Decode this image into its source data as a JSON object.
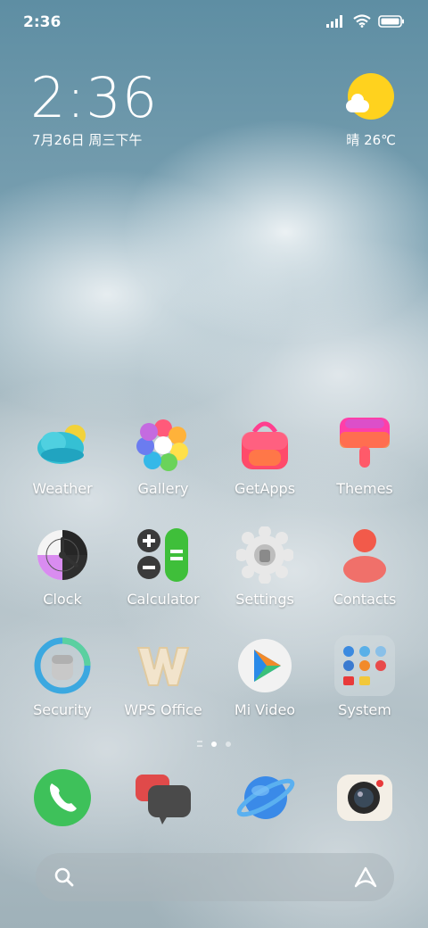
{
  "status": {
    "time": "2:36"
  },
  "clock_widget": {
    "time": "2:36",
    "date": "7月26日 周三下午"
  },
  "weather_widget": {
    "text": "晴 26℃"
  },
  "apps": [
    {
      "label": "Weather",
      "icon": "weather-icon"
    },
    {
      "label": "Gallery",
      "icon": "gallery-icon"
    },
    {
      "label": "GetApps",
      "icon": "getapps-icon"
    },
    {
      "label": "Themes",
      "icon": "themes-icon"
    },
    {
      "label": "Clock",
      "icon": "clock-icon"
    },
    {
      "label": "Calculator",
      "icon": "calculator-icon"
    },
    {
      "label": "Settings",
      "icon": "settings-icon"
    },
    {
      "label": "Contacts",
      "icon": "contacts-icon"
    },
    {
      "label": "Security",
      "icon": "security-icon"
    },
    {
      "label": "WPS Office",
      "icon": "wps-office-icon"
    },
    {
      "label": "Mi Video",
      "icon": "mi-video-icon"
    },
    {
      "label": "System",
      "icon": "system-folder-icon"
    }
  ],
  "dock": [
    "phone-icon",
    "messages-icon",
    "browser-icon",
    "camera-icon"
  ],
  "pages": {
    "count": 2,
    "active": 1
  },
  "colors": {
    "sun": "#ffd21e",
    "phone": "#3ec15a",
    "calc_green": "#3fbf3a"
  }
}
